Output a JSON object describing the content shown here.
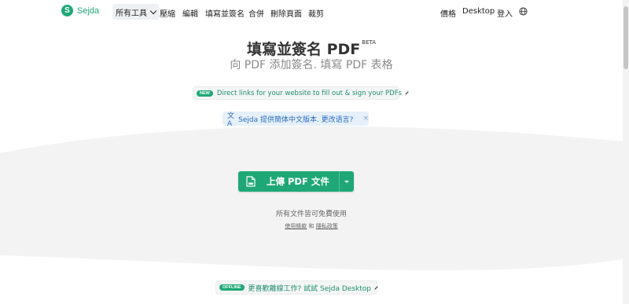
{
  "brand": {
    "name": "Sejda",
    "color": "#1fa876"
  },
  "nav": {
    "all_tools": "所有工具",
    "links": [
      "壓縮",
      "編輯",
      "填寫並簽名",
      "合併",
      "刪除頁面",
      "裁剪"
    ],
    "pricing": "價格",
    "desktop": "Desktop",
    "login": "登入"
  },
  "hero": {
    "title": "填寫並簽名 PDF",
    "beta": "BETA",
    "subtitle": "向 PDF 添加簽名. 填寫 PDF 表格"
  },
  "promo": {
    "badge": "NEW",
    "text": "Direct links for your website to fill out & sign your PDFs"
  },
  "lang_notice": {
    "text": "Sejda 提供簡体中文版本. 更改语言?",
    "close": "×"
  },
  "upload": {
    "label": "上傳 PDF 文件"
  },
  "footer": {
    "free_text": "所有文件皆可免費使用",
    "terms": "使用條款",
    "and": "和",
    "privacy": "隱私政策"
  },
  "offline": {
    "badge": "OFFLINE",
    "text": "更喜歡離線工作? 試試 Sejda Desktop"
  }
}
